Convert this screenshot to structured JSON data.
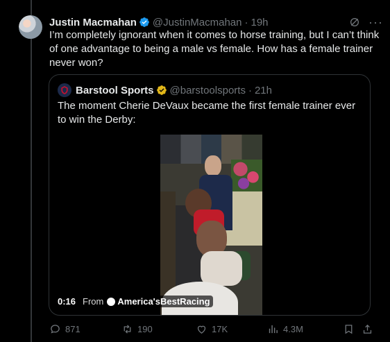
{
  "tweet": {
    "author_name": "Justin Macmahan",
    "handle": "@JustinMacmahan",
    "separator": "·",
    "time": "19h",
    "text": "I’m completely ignorant when it comes to horse training, but I can’t think of one advantage to being a male vs female. How has a female trainer never won?",
    "verified_color": "#1d9bf0"
  },
  "quote": {
    "author_name": "Barstool Sports",
    "handle": "@barstoolsports",
    "separator": "·",
    "time": "21h",
    "text": "The moment Cherie DeVaux became the first female trainer ever to win the Derby:",
    "verified_color": "#e2b719",
    "video": {
      "duration": "0:16",
      "from_label": "From",
      "source": "America'sBestRacing"
    }
  },
  "actions": {
    "reply_count": "871",
    "repost_count": "190",
    "like_count": "17K",
    "view_count": "4.3M"
  },
  "icons": [
    "grok-icon",
    "more-icon",
    "verified-badge-icon",
    "reply-icon",
    "repost-icon",
    "like-icon",
    "views-icon",
    "bookmark-icon",
    "share-icon"
  ]
}
